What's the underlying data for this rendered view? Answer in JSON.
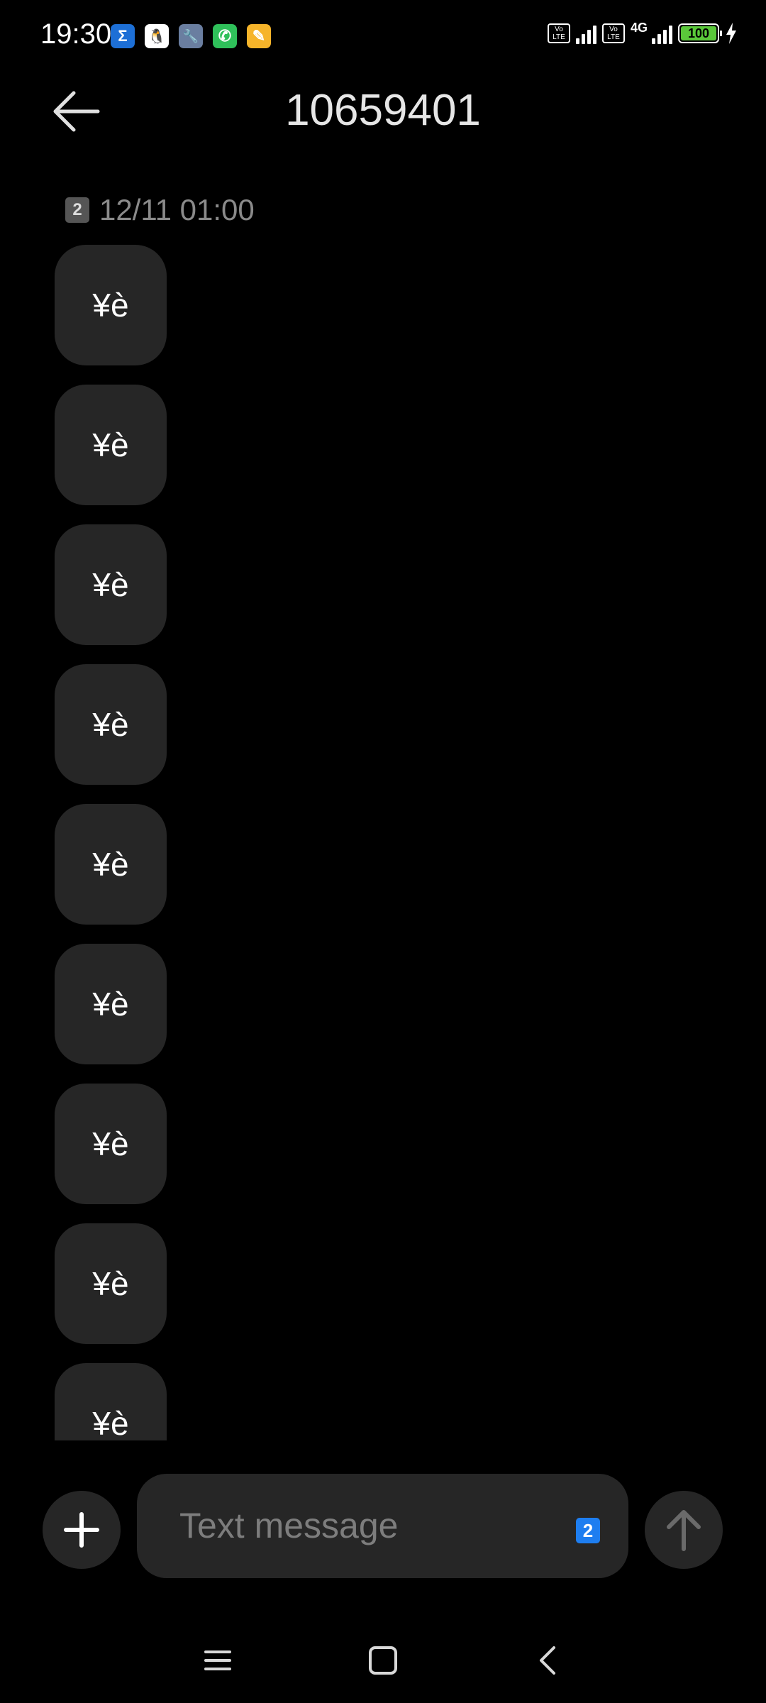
{
  "status_bar": {
    "time": "19:30",
    "apps": [
      {
        "icon": "sigma-app-icon",
        "glyph": "Σ",
        "color": "#1d6fd6"
      },
      {
        "icon": "qq-app-icon",
        "glyph": "🐧",
        "color": "#ffffff"
      },
      {
        "icon": "wrench-app-icon",
        "glyph": "🔧",
        "color": "#6a7ea0"
      },
      {
        "icon": "phone-app-icon",
        "glyph": "✆",
        "color": "#2fc05a"
      },
      {
        "icon": "notes-app-icon",
        "glyph": "✎",
        "color": "#f6b42a"
      }
    ],
    "volte_label": "Vo LTE",
    "network": "4G",
    "battery": "100"
  },
  "header": {
    "title": "10659401"
  },
  "conversation": {
    "sim_slot": "2",
    "timestamp": "12/11 01:00",
    "messages": [
      "¥è",
      "¥è",
      "¥è",
      "¥è",
      "¥è",
      "¥è",
      "¥è",
      "¥è",
      "¥è"
    ]
  },
  "composer": {
    "placeholder": "Text message",
    "sim_slot": "2"
  },
  "nav": {
    "icons": [
      "menu-icon",
      "home-icon",
      "back-icon"
    ]
  },
  "colors": {
    "background": "#000000",
    "bubble": "#262626",
    "accent": "#1e7ef0",
    "battery": "#5ac83a"
  }
}
